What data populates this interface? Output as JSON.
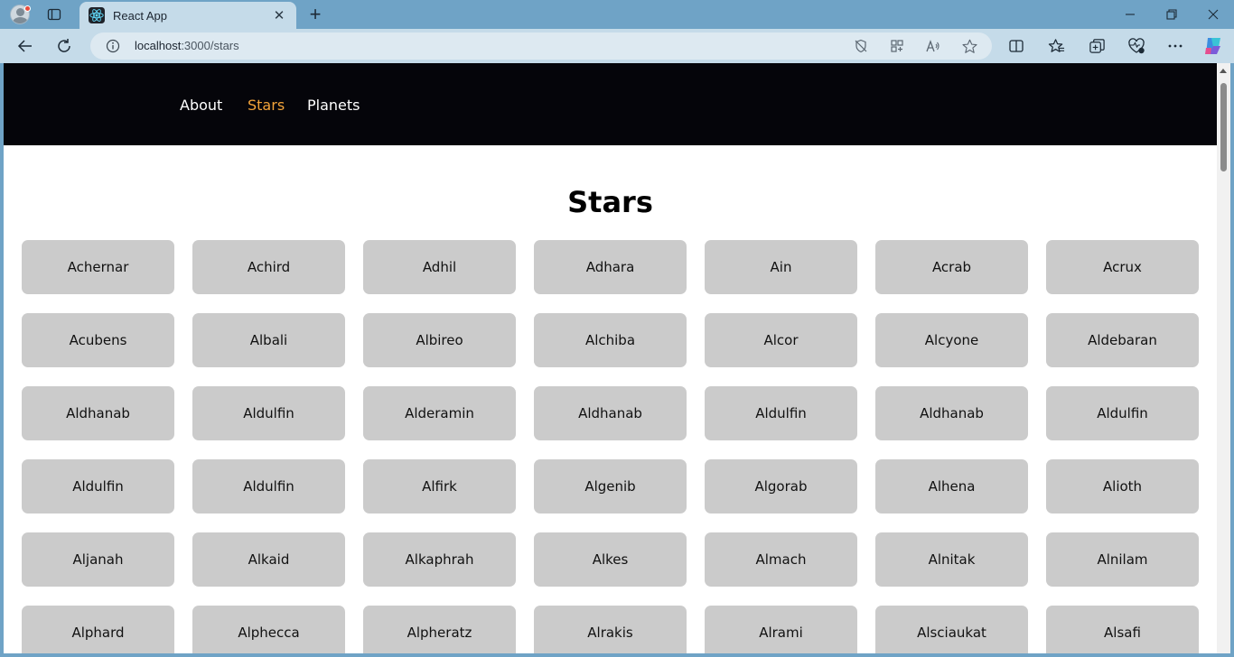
{
  "browser": {
    "tab_title": "React App",
    "url_host": "localhost",
    "url_rest": ":3000/stars"
  },
  "site": {
    "nav": [
      {
        "label": "About",
        "active": false
      },
      {
        "label": "Stars",
        "active": true
      },
      {
        "label": "Planets",
        "active": false
      }
    ],
    "nav_active_color": "#f2a33a",
    "nav_bg_color": "#05050a"
  },
  "page": {
    "title": "Stars",
    "stars": [
      "Achernar",
      "Achird",
      "Adhil",
      "Adhara",
      "Ain",
      "Acrab",
      "Acrux",
      "Acubens",
      "Albali",
      "Albireo",
      "Alchiba",
      "Alcor",
      "Alcyone",
      "Aldebaran",
      "Aldhanab",
      "Aldulfin",
      "Alderamin",
      "Aldhanab",
      "Aldulfin",
      "Aldhanab",
      "Aldulfin",
      "Aldulfin",
      "Aldulfin",
      "Alfirk",
      "Algenib",
      "Algorab",
      "Alhena",
      "Alioth",
      "Aljanah",
      "Alkaid",
      "Alkaphrah",
      "Alkes",
      "Almach",
      "Alnitak",
      "Alnilam",
      "Alphard",
      "Alphecca",
      "Alpheratz",
      "Alrakis",
      "Alrami",
      "Alsciaukat",
      "Alsafi"
    ]
  }
}
